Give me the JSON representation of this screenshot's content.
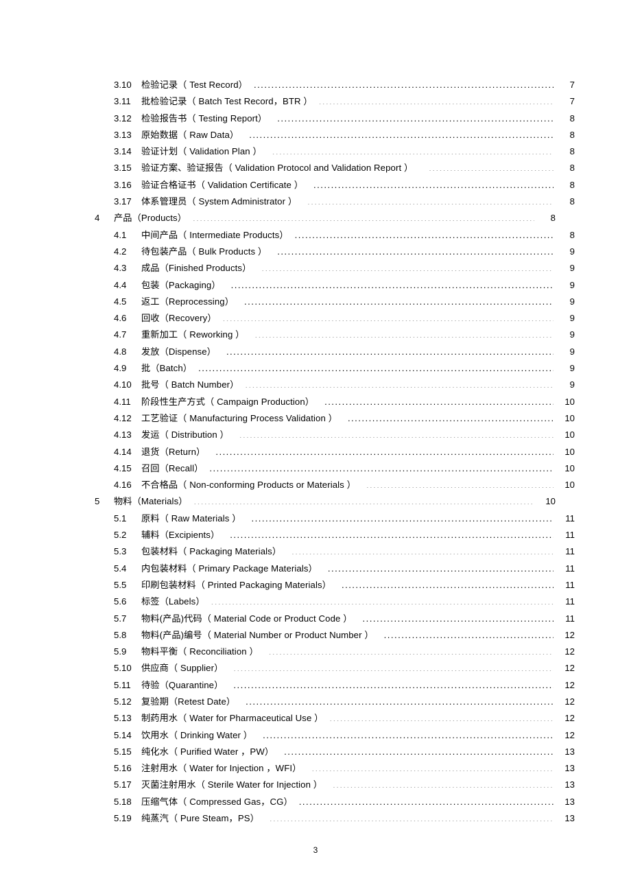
{
  "document": {
    "folio": "3"
  },
  "toc": {
    "entries": [
      {
        "level": 2,
        "num": "3.10",
        "title": "检验记录（ Test Record）",
        "page": "7",
        "gap": "sm"
      },
      {
        "level": 2,
        "num": "3.11",
        "title": "批检验记录（ Batch Test Record，BTR ）",
        "page": "7",
        "gap": "sm"
      },
      {
        "level": 2,
        "num": "3.12",
        "title": "检验报告书（ Testing Report）",
        "page": "8",
        "gap": "md"
      },
      {
        "level": 2,
        "num": "3.13",
        "title": "原始数据（ Raw Data）",
        "page": "8",
        "gap": "md"
      },
      {
        "level": 2,
        "num": "3.14",
        "title": "验证计划（ Validation Plan ）",
        "page": "8",
        "gap": "md"
      },
      {
        "level": 2,
        "num": "3.15",
        "title": "验证方案、验证报告（    Validation Protocol and Validation Report  ）",
        "page": "8",
        "gap": "lg"
      },
      {
        "level": 2,
        "num": "3.16",
        "title": "验证合格证书（  Validation Certificate  ）",
        "page": "8",
        "gap": "md"
      },
      {
        "level": 2,
        "num": "3.17",
        "title": "体系管理员（ System Administrator ）",
        "page": "8",
        "gap": "md"
      },
      {
        "level": 1,
        "num": "4",
        "title": "产品（Products）",
        "page": "8",
        "gap": "sm"
      },
      {
        "level": 2,
        "num": "4.1",
        "title": "中间产品（ Intermediate Products）",
        "page": "8",
        "gap": "sm"
      },
      {
        "level": 2,
        "num": "4.2",
        "title": "待包装产品（ Bulk Products ）",
        "page": "9",
        "gap": "md"
      },
      {
        "level": 2,
        "num": "4.3",
        "title": "成品（Finished Products）",
        "page": "9",
        "gap": "md"
      },
      {
        "level": 2,
        "num": "4.4",
        "title": "包装（Packaging）",
        "page": "9",
        "gap": "md"
      },
      {
        "level": 2,
        "num": "4.5",
        "title": "返工（Reprocessing）",
        "page": "9",
        "gap": "md"
      },
      {
        "level": 2,
        "num": "4.6",
        "title": "回收（Recovery）",
        "page": "9",
        "gap": "sm"
      },
      {
        "level": 2,
        "num": "4.7",
        "title": "重新加工（ Reworking ）",
        "page": "9",
        "gap": "md"
      },
      {
        "level": 2,
        "num": "4.8",
        "title": "发放（Dispense）",
        "page": "9",
        "gap": "md"
      },
      {
        "level": 2,
        "num": "4.9",
        "title": "批（Batch）",
        "page": "9",
        "gap": "sm"
      },
      {
        "level": 2,
        "num": "4.10",
        "title": "批号（ Batch Number）",
        "page": "9",
        "gap": "sm"
      },
      {
        "level": 2,
        "num": "4.11",
        "title": "阶段性生产方式（  Campaign Production）",
        "page": "10",
        "gap": "md"
      },
      {
        "level": 2,
        "num": "4.12",
        "title": "工艺验证（ Manufacturing Process Validation ）",
        "page": "10",
        "gap": "md"
      },
      {
        "level": 2,
        "num": "4.13",
        "title": "发运（ Distribution ）",
        "page": "10",
        "gap": "md"
      },
      {
        "level": 2,
        "num": "4.14",
        "title": "退货（Return）",
        "page": "10",
        "gap": "md"
      },
      {
        "level": 2,
        "num": "4.15",
        "title": "召回（Recall）",
        "page": "10",
        "gap": "sm"
      },
      {
        "level": 2,
        "num": "4.16",
        "title": "不合格品（ Non-conforming Products or Materials  ）",
        "page": "10",
        "gap": "md"
      },
      {
        "level": 1,
        "num": "5",
        "title": "物料（Materials）",
        "page": "10",
        "gap": "sm"
      },
      {
        "level": 2,
        "num": "5.1",
        "title": "原料（ Raw Materials ）",
        "page": "11",
        "gap": "md"
      },
      {
        "level": 2,
        "num": "5.2",
        "title": "辅料（Excipients）",
        "page": "11",
        "gap": "md"
      },
      {
        "level": 2,
        "num": "5.3",
        "title": "包装材料（ Packaging Materials）",
        "page": "11",
        "gap": "md"
      },
      {
        "level": 2,
        "num": "5.4",
        "title": "内包装材料（ Primary Package Materials）",
        "page": "11",
        "gap": "md"
      },
      {
        "level": 2,
        "num": "5.5",
        "title": "印刷包装材料（ Printed Packaging Materials）",
        "page": "11",
        "gap": "md"
      },
      {
        "level": 2,
        "num": "5.6",
        "title": "标签（Labels）",
        "page": "11",
        "gap": "sm"
      },
      {
        "level": 2,
        "num": "5.7",
        "title": "物料(产品)代码（ Material Code or Product Code ）",
        "page": "11",
        "gap": "md"
      },
      {
        "level": 2,
        "num": "5.8",
        "title": "物料(产品)编号（ Material Number or Product Number ）",
        "page": "12",
        "gap": "md"
      },
      {
        "level": 2,
        "num": "5.9",
        "title": "物料平衡（ Reconciliation ）",
        "page": "12",
        "gap": "md"
      },
      {
        "level": 2,
        "num": "5.10",
        "title": "供应商（ Supplier）",
        "page": "12",
        "gap": "md"
      },
      {
        "level": 2,
        "num": "5.11",
        "title": "待验（Quarantine）",
        "page": "12",
        "gap": "md"
      },
      {
        "level": 2,
        "num": "5.12",
        "title": "复验期（Retest Date）",
        "page": "12",
        "gap": "md"
      },
      {
        "level": 2,
        "num": "5.13",
        "title": "制药用水（ Water for Pharmaceutical Use ）",
        "page": "12",
        "gap": "sm"
      },
      {
        "level": 2,
        "num": "5.14",
        "title": "饮用水（ Drinking Water ）",
        "page": "12",
        "gap": "md"
      },
      {
        "level": 2,
        "num": "5.15",
        "title": "纯化水（ Purified Water ，PW）",
        "page": "13",
        "gap": "md"
      },
      {
        "level": 2,
        "num": "5.16",
        "title": "注射用水（ Water for Injection ，WFI）",
        "page": "13",
        "gap": "md"
      },
      {
        "level": 2,
        "num": "5.17",
        "title": "灭菌注射用水（  Sterile Water for Injection ）",
        "page": "13",
        "gap": "md"
      },
      {
        "level": 2,
        "num": "5.18",
        "title": "压缩气体（ Compressed Gas，CG）",
        "page": "13",
        "gap": "sm"
      },
      {
        "level": 2,
        "num": "5.19",
        "title": "纯蒸汽（ Pure Steam，PS）",
        "page": "13",
        "gap": "md"
      }
    ]
  }
}
